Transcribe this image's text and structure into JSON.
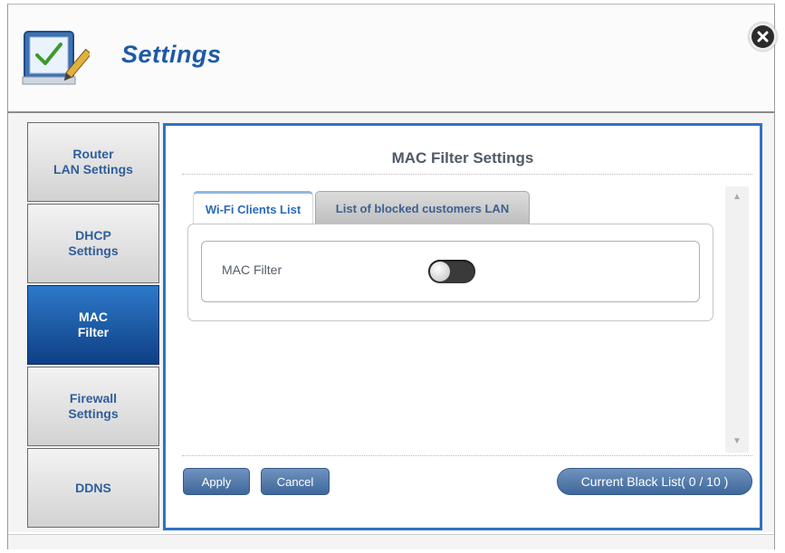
{
  "header": {
    "title": "Settings",
    "app_icon": "settings-checklist-icon",
    "close_icon": "close-icon"
  },
  "sidebar": {
    "items": [
      {
        "label": "Router\nLAN Settings",
        "active": false
      },
      {
        "label": "DHCP\nSettings",
        "active": false
      },
      {
        "label": "MAC\nFilter",
        "active": true
      },
      {
        "label": "Firewall\nSettings",
        "active": false
      },
      {
        "label": "DDNS",
        "active": false
      }
    ]
  },
  "main": {
    "title": "MAC Filter Settings",
    "tabs": [
      {
        "label": "Wi-Fi Clients List",
        "active": true
      },
      {
        "label": "List of blocked customers LAN",
        "active": false
      }
    ],
    "mac_filter": {
      "label": "MAC Filter",
      "enabled": false
    },
    "buttons": {
      "apply": "Apply",
      "cancel": "Cancel",
      "black_list": "Current Black List( 0 / 10 )"
    }
  },
  "colors": {
    "accent": "#1e5aa6",
    "panel_border": "#2f73c0",
    "button": "#4f77a8",
    "active_sidebar": "#154c94"
  }
}
